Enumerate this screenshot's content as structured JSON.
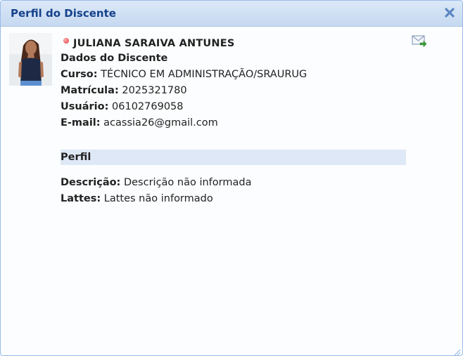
{
  "window": {
    "title": "Perfil do Discente",
    "close_icon": "close-icon"
  },
  "student": {
    "name": "JULIANA SARAIVA ANTUNES",
    "status_color": "#e0363a",
    "section_title": "Dados do Discente",
    "curso_label": "Curso:",
    "curso_value": "TÉCNICO EM ADMINISTRAÇÃO/SRAURUG",
    "matricula_label": "Matrícula:",
    "matricula_value": "2025321780",
    "usuario_label": "Usuário:",
    "usuario_value": "06102769058",
    "email_label": "E-mail:",
    "email_value": "acassia26@gmail.com"
  },
  "perfil": {
    "header": "Perfil",
    "descricao_label": "Descrição:",
    "descricao_value": "Descrição não informada",
    "lattes_label": "Lattes:",
    "lattes_value": "Lattes não informado"
  },
  "colors": {
    "title_text": "#15428b",
    "section_bg": "#dfe8f6"
  }
}
